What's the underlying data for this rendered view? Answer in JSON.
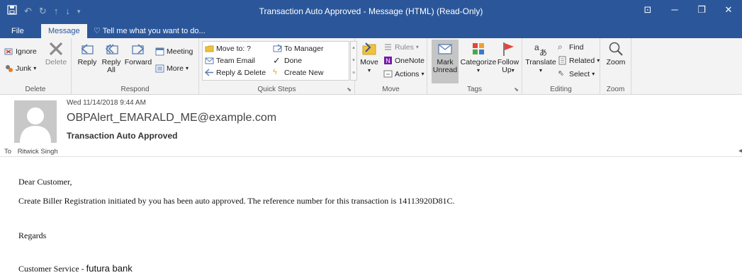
{
  "window": {
    "title": "Transaction Auto Approved - Message (HTML) (Read-Only)"
  },
  "tabs": {
    "file": "File",
    "message": "Message",
    "tell_me": "Tell me what you want to do..."
  },
  "ribbon": {
    "delete_group": {
      "ignore": "Ignore",
      "junk": "Junk",
      "delete": "Delete",
      "label": "Delete"
    },
    "respond_group": {
      "reply": "Reply",
      "reply_all_1": "Reply",
      "reply_all_2": "All",
      "forward": "Forward",
      "meeting": "Meeting",
      "more": "More",
      "label": "Respond"
    },
    "quick_steps": {
      "move_to": "Move to: ?",
      "team_email": "Team Email",
      "reply_delete": "Reply & Delete",
      "to_manager": "To Manager",
      "done": "Done",
      "create_new": "Create New",
      "label": "Quick Steps"
    },
    "move_group": {
      "move": "Move",
      "rules": "Rules",
      "onenote": "OneNote",
      "actions": "Actions",
      "label": "Move"
    },
    "tags_group": {
      "mark_1": "Mark",
      "mark_2": "Unread",
      "categorize": "Categorize",
      "follow_1": "Follow",
      "follow_2": "Up",
      "label": "Tags"
    },
    "editing_group": {
      "translate": "Translate",
      "find": "Find",
      "related": "Related",
      "select": "Select",
      "label": "Editing"
    },
    "zoom_group": {
      "zoom": "Zoom",
      "label": "Zoom"
    }
  },
  "message": {
    "date": "Wed 11/14/2018 9:44 AM",
    "sender": "OBPAlert_EMARALD_ME@example.com",
    "subject": "Transaction Auto Approved",
    "to_label": "To",
    "to_name": "Ritwick Singh",
    "greeting": "Dear Customer,",
    "body": "Create Biller Registration initiated by you has been auto approved. The reference number for this transaction is 14113920D81C.",
    "regards": "Regards",
    "signature_prefix": "Customer Service - ",
    "signature_bank": "futura bank"
  },
  "colors": {
    "accent": "#2b579a",
    "ribbon_bg": "#f3f3f3",
    "flag_red": "#e8443a"
  }
}
